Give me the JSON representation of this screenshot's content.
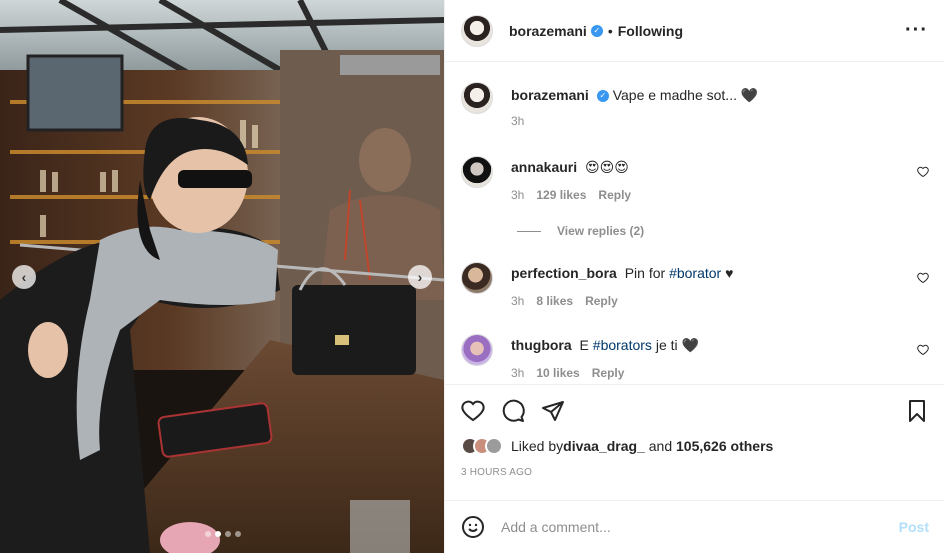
{
  "post": {
    "author": "borazemani",
    "follow_status": "Following",
    "more_icon": "more-horizontal-icon",
    "caption_author": "borazemani",
    "caption": "Vape e madhe sot... 🖤",
    "caption_time": "3h"
  },
  "comments": [
    {
      "username": "annakauri",
      "text": "😍😍😍",
      "time": "3h",
      "likes": "129 likes",
      "reply": "Reply"
    },
    {
      "username": "perfection_bora",
      "text_before": "Pin for ",
      "hashtag": "#borator",
      "text_after": " ♥",
      "time": "3h",
      "likes": "8 likes",
      "reply": "Reply"
    },
    {
      "username": "thugbora",
      "text_before": "E ",
      "hashtag": "#borators",
      "text_after": " je ti 🖤",
      "time": "3h",
      "likes": "10 likes",
      "reply": "Reply"
    }
  ],
  "view_replies": "View replies (2)",
  "likes": {
    "prefix": "Liked by ",
    "first_user": "divaa_drag_",
    "middle": " and ",
    "others": "105,626 others"
  },
  "timestamp": "3 HOURS AGO",
  "composer": {
    "placeholder": "Add a comment...",
    "post_label": "Post"
  },
  "carousel": {
    "total_slides": 4,
    "active_slide": 2
  },
  "colors": {
    "link": "#00376b",
    "verified": "#3897f0",
    "post_disabled": "#b2dffc",
    "muted": "#8e8e8e"
  }
}
